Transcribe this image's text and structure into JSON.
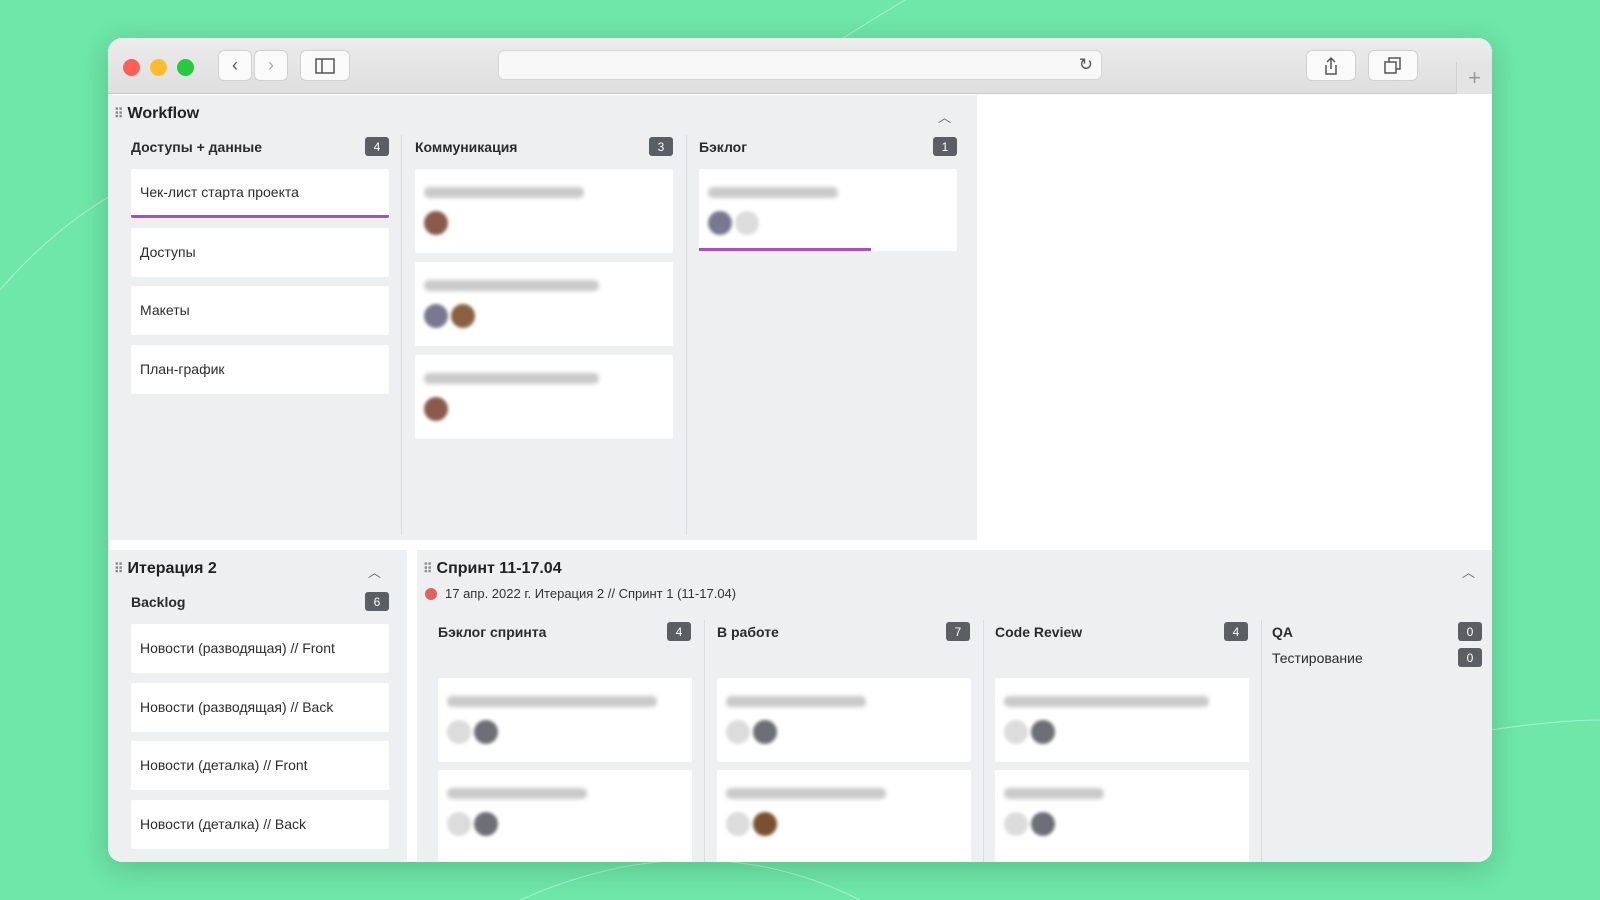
{
  "workflow": {
    "title": "Workflow",
    "columns": [
      {
        "title": "Доступы + данные",
        "count": "4",
        "cards": [
          "Чек-лист старта проекта",
          "Доступы",
          "Макеты",
          "План-график"
        ]
      },
      {
        "title": "Коммуникация",
        "count": "3"
      },
      {
        "title": "Бэклог",
        "count": "1"
      }
    ]
  },
  "iteration": {
    "title": "Итерация 2",
    "backlog_title": "Backlog",
    "backlog_count": "6",
    "cards": [
      "Новости (разводящая) // Front",
      "Новости (разводящая) // Back",
      "Новости (деталка) // Front",
      "Новости (деталка) // Back"
    ]
  },
  "sprint": {
    "title": "Спринт 11-17.04",
    "meta": "17 апр. 2022 г. Итерация 2 // Спринт 1 (11-17.04)",
    "columns": [
      {
        "title": "Бэклог спринта",
        "count": "4"
      },
      {
        "title": "В работе",
        "count": "7"
      },
      {
        "title": "Code Review",
        "count": "4"
      },
      {
        "title": "QA",
        "count": "0",
        "sub_title": "Тестирование",
        "sub_count": "0"
      }
    ]
  },
  "colors": {
    "accent": "#a64fbf",
    "background": "#6ee7a8",
    "badge": "#5b5f63"
  }
}
